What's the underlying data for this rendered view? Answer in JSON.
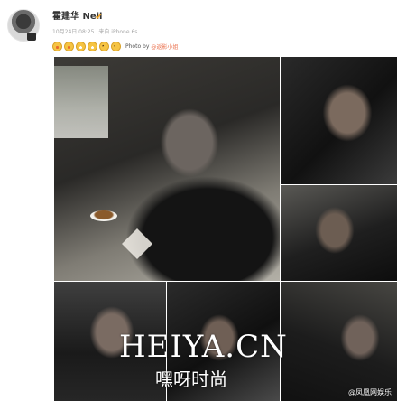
{
  "post": {
    "user_name": "霍建华 Neil",
    "verified_icon": "verified-badge-icon",
    "meta": {
      "date": "10月24日 08:25",
      "source": "来自 iPhone 6s"
    },
    "emojis": [
      "laughing-emoji-icon",
      "laughing-emoji-icon",
      "rose-emoji-icon",
      "grin-emoji-icon",
      "wink-emoji-icon",
      "wink-emoji-icon"
    ],
    "photo_label": "Photo by",
    "photo_credit": "@返影小姐"
  },
  "photos": {
    "count": 6,
    "items": [
      "photo-1",
      "photo-2",
      "photo-3",
      "photo-4",
      "photo-5",
      "photo-6"
    ]
  },
  "overlay": {
    "watermark": "HEIYA.CN",
    "watermark_sub": "嘿呀时尚",
    "corner_mark": "@凤凰网娱乐"
  },
  "colors": {
    "accent_orange": "#eb7350",
    "verified_gold": "#f5a623",
    "meta_gray": "#a8a8a8"
  }
}
